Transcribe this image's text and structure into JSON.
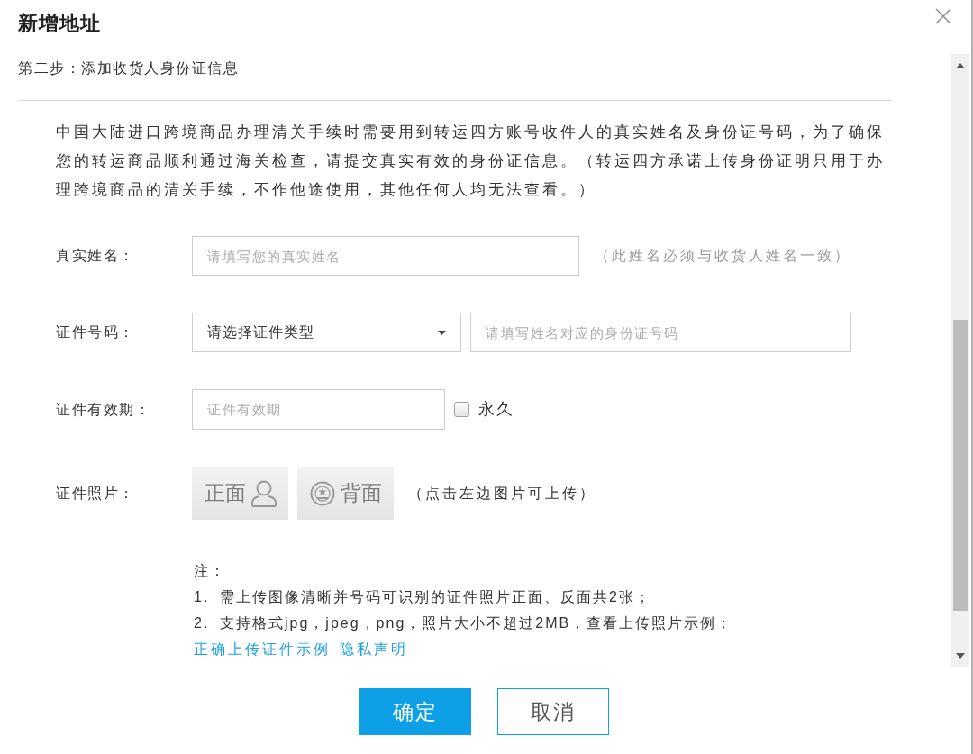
{
  "dialog": {
    "title": "新增地址"
  },
  "step": "第二步：添加收货人身份证信息",
  "intro": "中国大陆进口跨境商品办理清关手续时需要用到转运四方账号收件人的真实姓名及身份证号码，为了确保您的转运商品顺利通过海关检查，请提交真实有效的身份证信息。（转运四方承诺上传身份证明只用于办理跨境商品的清关手续，不作他途使用，其他任何人均无法查看。）",
  "fields": [
    {
      "kind": "text",
      "label": "真实姓名：",
      "placeholder": "请填写您的真实姓名",
      "hint": "（此姓名必须与收货人姓名一致）"
    },
    {
      "kind": "select_input",
      "label": "证件号码：",
      "select": "请选择证件类型",
      "placeholder": "请填写姓名对应的身份证号码"
    },
    {
      "kind": "date",
      "label": "证件有效期：",
      "placeholder": "证件有效期",
      "checkbox": {
        "label": "永久",
        "checked": false
      }
    },
    {
      "kind": "photos",
      "label": "证件照片：",
      "tiles": [
        {
          "kind": "front",
          "label": "正面"
        },
        {
          "kind": "back",
          "label": "背面"
        }
      ],
      "hint": "（点击左边图片可上传）"
    }
  ],
  "notes": {
    "title": "注：",
    "items": [
      {
        "number": "1.",
        "text": "需上传图像清晰并号码可识别的证件照片正面、反面共2张；"
      },
      {
        "number": "2.",
        "text": "支持格式jpg，jpeg，png，照片大小不超过2MB，查看上传照片示例；"
      }
    ],
    "links": [
      "正确上传证件示例",
      "隐私声明"
    ]
  },
  "buttons": [
    {
      "kind": "primary",
      "label": "确定"
    },
    {
      "kind": "secondary",
      "label": "取消"
    }
  ]
}
